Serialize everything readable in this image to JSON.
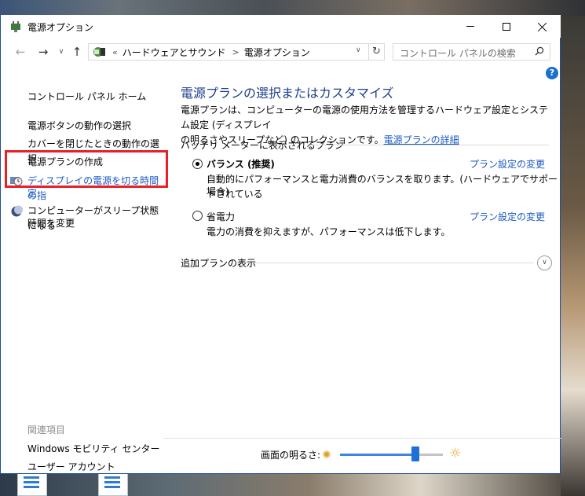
{
  "window": {
    "title": "電源オプション",
    "minimize_icon": "minimize-icon",
    "maximize_icon": "maximize-icon",
    "close_icon": "close-icon"
  },
  "navbar": {
    "address": {
      "overflow": "«",
      "path": [
        "ハードウェアとサウンド",
        "電源オプション"
      ],
      "separator": ">"
    },
    "search_placeholder": "コントロール パネルの検索"
  },
  "sidebar": {
    "home": "コントロール パネル ホーム",
    "links": [
      "電源ボタンの動作の選択",
      "カバーを閉じたときの動作の選択",
      "電源プランの作成"
    ],
    "display_link": [
      "ディスプレイの電源を切る時間の指",
      "定"
    ],
    "sleep_link": [
      "コンピューターがスリープ状態になる",
      "時間を変更"
    ],
    "related_heading": "関連項目",
    "related": [
      "Windows モビリティ センター",
      "ユーザー アカウント"
    ]
  },
  "main": {
    "heading": "電源プランの選択またはカスタマイズ",
    "description": [
      "電源プランは、コンピューターの電源の使用方法を管理するハードウェア設定とシステム設定 (ディスプレイ",
      "の明るさやスリープなど) のコレクションです。"
    ],
    "description_link": "電源プランの詳細",
    "section_title": "バッテリ メーターに表示されるプラン",
    "plans": [
      {
        "name": "バランス (推奨)",
        "selected": true,
        "description": [
          "自動的にパフォーマンスと電力消費のバランスを取ります。(ハードウェアでサポートされている",
          "場合)"
        ],
        "link": "プラン設定の変更"
      },
      {
        "name": "省電力",
        "selected": false,
        "description": [
          "電力の消費を抑えますが、パフォーマンスは低下します。"
        ],
        "link": "プラン設定の変更"
      }
    ],
    "additional_plans": "追加プランの表示"
  },
  "footer": {
    "brightness_label": "画面の明るさ:",
    "brightness_value": 0.73
  },
  "colors": {
    "link": "#1a59c4",
    "heading": "#1e3f8a",
    "highlight_box": "#e8202a",
    "slider": "#1f6fd8"
  }
}
